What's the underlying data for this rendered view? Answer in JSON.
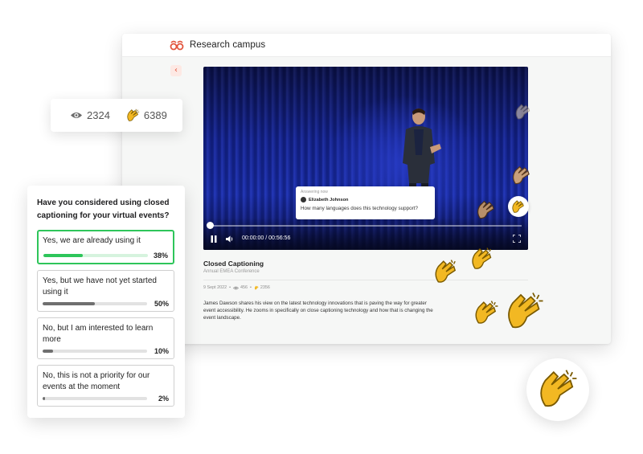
{
  "app": {
    "name": "Research campus",
    "brand_color": "#e2553d"
  },
  "video": {
    "question_card": {
      "kicker": "Answering now",
      "user": "Elizabeth Johnson",
      "question": "How many languages does this technology support?"
    },
    "time": "00:00:00 / 00:56:56",
    "progress": 0.0
  },
  "details": {
    "title": "Closed Captioning",
    "subtitle": "Annual EMEA Conference",
    "date": "9 Sept 2022",
    "views": "456",
    "claps": "2356",
    "description": "James Dawson shares his view on the latest technology innovations that is paving the way for greater event accessibility. He zooms in specifically on close captioning technology and how that is changing the event landscape."
  },
  "stats": {
    "views": "2324",
    "claps": "6389"
  },
  "poll": {
    "question": "Have you considered using closed captioning for your virtual events?",
    "options": [
      {
        "label": "Yes, we are already using it",
        "pct": "38%",
        "value": 0.38,
        "selected": true
      },
      {
        "label": "Yes, but we have not yet started using it",
        "pct": "50%",
        "value": 0.5,
        "selected": false
      },
      {
        "label": "No, but I am interested to learn more",
        "pct": "10%",
        "value": 0.1,
        "selected": false
      },
      {
        "label": "No, this is not a priority for our events at the moment",
        "pct": "2%",
        "value": 0.02,
        "selected": false
      }
    ],
    "accent": "#2ec55a"
  },
  "icons": [
    "brand-logo-icon",
    "back-chevron-icon",
    "eye-icon",
    "clap-icon",
    "pause-icon",
    "volume-icon",
    "fullscreen-icon"
  ]
}
